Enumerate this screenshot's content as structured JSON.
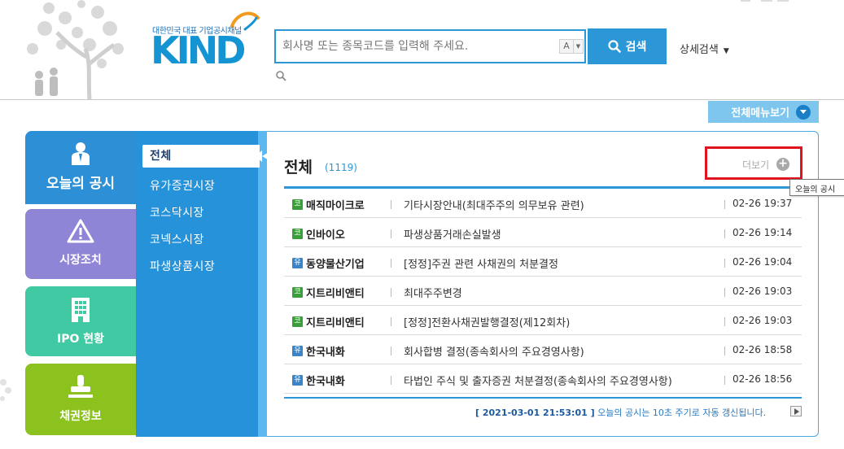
{
  "header": {
    "logo_tagline": "대한민국 대표 기업공시채널",
    "logo_wordmark": "KIND",
    "search_placeholder": "회사명 또는 종목코드를 입력해 주세요.",
    "autocomplete_label": "A",
    "search_button": "검색",
    "advanced_search": "상세검색",
    "all_menu": "전체메뉴보기"
  },
  "left_tabs": [
    {
      "label": "오늘의 공시",
      "icon": "person-icon"
    },
    {
      "label": "시장조치",
      "icon": "warning-icon"
    },
    {
      "label": "IPO 현황",
      "icon": "building-icon"
    },
    {
      "label": "채권정보",
      "icon": "stamp-icon"
    }
  ],
  "submenu": [
    {
      "label": "전체",
      "active": true
    },
    {
      "label": "유가증권시장"
    },
    {
      "label": "코스닥시장"
    },
    {
      "label": "코넥스시장"
    },
    {
      "label": "파생상품시장"
    }
  ],
  "panel": {
    "title": "전체",
    "count": "(1119)",
    "more_label": "더보기",
    "tooltip": "오늘의 공시",
    "rows": [
      {
        "badge": "코",
        "company": "매직마이크로",
        "title": "기타시장안내(최대주주의 의무보유 관련)",
        "time": "02-26 19:37"
      },
      {
        "badge": "코",
        "company": "인바이오",
        "title": "파생상품거래손실발생",
        "time": "02-26 19:14"
      },
      {
        "badge": "유",
        "company": "동양물산기업",
        "title": "[정정]주권 관련 사채권의 처분결정",
        "time": "02-26 19:04"
      },
      {
        "badge": "코",
        "company": "지트리비앤티",
        "title": "최대주주변경",
        "time": "02-26 19:03"
      },
      {
        "badge": "코",
        "company": "지트리비앤티",
        "title": "[정정]전환사채권발행결정(제12회차)",
        "time": "02-26 19:03"
      },
      {
        "badge": "유",
        "company": "한국내화",
        "title": "회사합병 결정(종속회사의 주요경영사항)",
        "time": "02-26 18:58"
      },
      {
        "badge": "유",
        "company": "한국내화",
        "title": "타법인 주식 및 출자증권 처분결정(종속회사의 주요경영사항)",
        "time": "02-26 18:56"
      }
    ],
    "footer_time": "[ 2021-03-01 21:53:01 ]",
    "footer_text": "오늘의 공시는 10초 주기로 자동 갱신됩니다."
  },
  "colors": {
    "brand_blue": "#2b97d6",
    "today_tab": "#2d8fd5",
    "market_tab": "#8e85d6",
    "ipo_tab": "#40c9a2",
    "bond_tab": "#8cc21d",
    "highlight_box": "#e0141e"
  }
}
